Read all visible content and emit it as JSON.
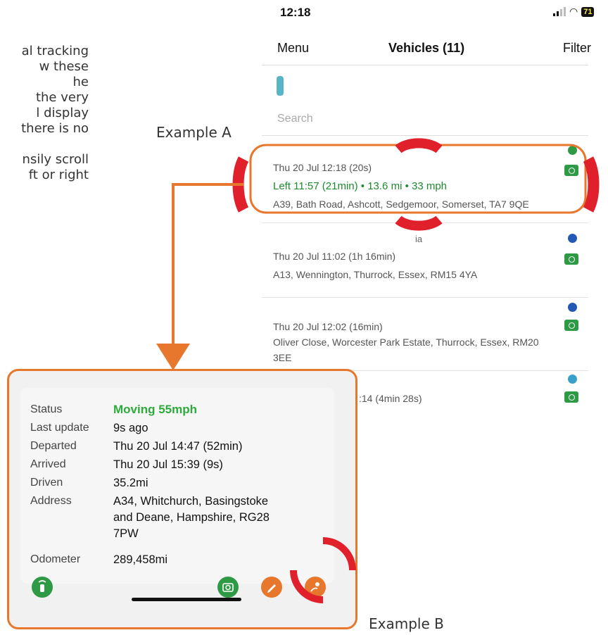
{
  "intro": {
    "lines": [
      "al tracking",
      "w these",
      "he",
      "the very",
      "l display",
      "there is no",
      "",
      "nsily scroll",
      "ft or right"
    ]
  },
  "annotations": {
    "example_a": "Example A",
    "example_b": "Example B"
  },
  "status_bar": {
    "time": "12:18",
    "battery": "71"
  },
  "nav": {
    "menu": "Menu",
    "title": "Vehicles (11)",
    "filter": "Filter"
  },
  "search": {
    "placeholder": "Search"
  },
  "vehicles": [
    {
      "line1": "Thu 20 Jul 12:18 (20s)",
      "line2": "Left 11:57 (21min) • 13.6 mi • 33 mph",
      "line3": "A39, Bath Road, Ashcott, Sedgemoor, Somerset, TA7 9QE",
      "dot_color": "#2e9a46"
    },
    {
      "label": "ia",
      "line1": "Thu 20 Jul 11:02 (1h 16min)",
      "line2": "A13, Wennington, Thurrock, Essex, RM15 4YA",
      "dot_color": "#2358b4"
    },
    {
      "line1": "Thu 20 Jul 12:02 (16min)",
      "line2": "Oliver Close, Worcester Park Estate, Thurrock, Essex, RM20",
      "line3": "3EE",
      "dot_color": "#2358b4"
    },
    {
      "line1": ":14 (4min 28s)",
      "dot_color": "#39a0c9"
    }
  ],
  "detail": {
    "rows": [
      {
        "label": "Status",
        "value": "Moving 55mph"
      },
      {
        "label": "Last update",
        "value": "9s ago"
      },
      {
        "label": "Departed",
        "value": "Thu 20 Jul 14:47 (52min)"
      },
      {
        "label": "Arrived",
        "value": "Thu 20 Jul 15:39 (9s)"
      },
      {
        "label": "Driven",
        "value": "35.2mi"
      },
      {
        "label": "Address",
        "value_lines": [
          "A34, Whitchurch, Basingstoke",
          "and Deane, Hampshire, RG28",
          "7PW"
        ]
      },
      {
        "label": "Odometer",
        "value": "289,458mi"
      }
    ]
  },
  "colors": {
    "accent_orange": "#e8772e",
    "highlight_red": "#e0202a",
    "status_green": "#2eaa3c",
    "camera_green": "#2e9a46"
  },
  "icons": [
    "fob-icon",
    "camera-icon",
    "edit-icon",
    "route-icon",
    "wifi-icon",
    "signal-icon",
    "battery-icon"
  ]
}
